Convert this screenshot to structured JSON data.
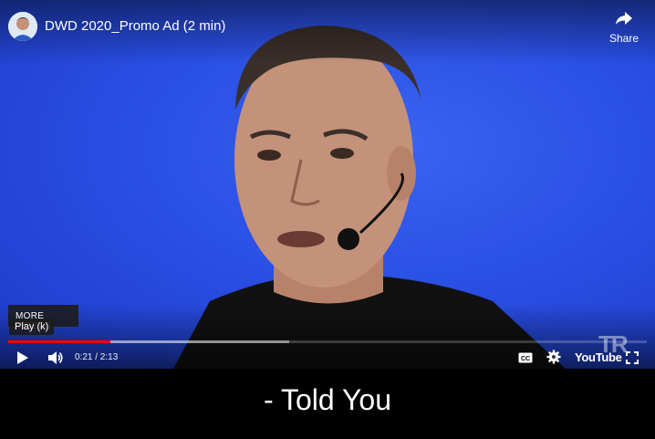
{
  "video": {
    "title": "DWD 2020_Promo Ad (2 min)",
    "share_label": "Share",
    "channel_avatar_icon": "channel-avatar",
    "watermark": "TR"
  },
  "overlay": {
    "more_videos_label": "MORE VIDEOS",
    "tooltip_label": "Play (k)"
  },
  "controls": {
    "current_time": "0:21",
    "duration": "2:13",
    "time_display": "0:21 / 2:13",
    "played_fraction": 0.16,
    "loaded_fraction": 0.44,
    "play_icon": "play-icon",
    "volume_icon": "volume-icon",
    "cc_icon": "cc-icon",
    "settings_icon": "gear-icon",
    "logo_text": "YouTube",
    "fullscreen_icon": "fullscreen-icon"
  },
  "subtitle": {
    "text": "- Told You"
  },
  "colors": {
    "background": "#2a4fe4",
    "progress_played": "#ff0000",
    "caption_bg": "#000000"
  }
}
